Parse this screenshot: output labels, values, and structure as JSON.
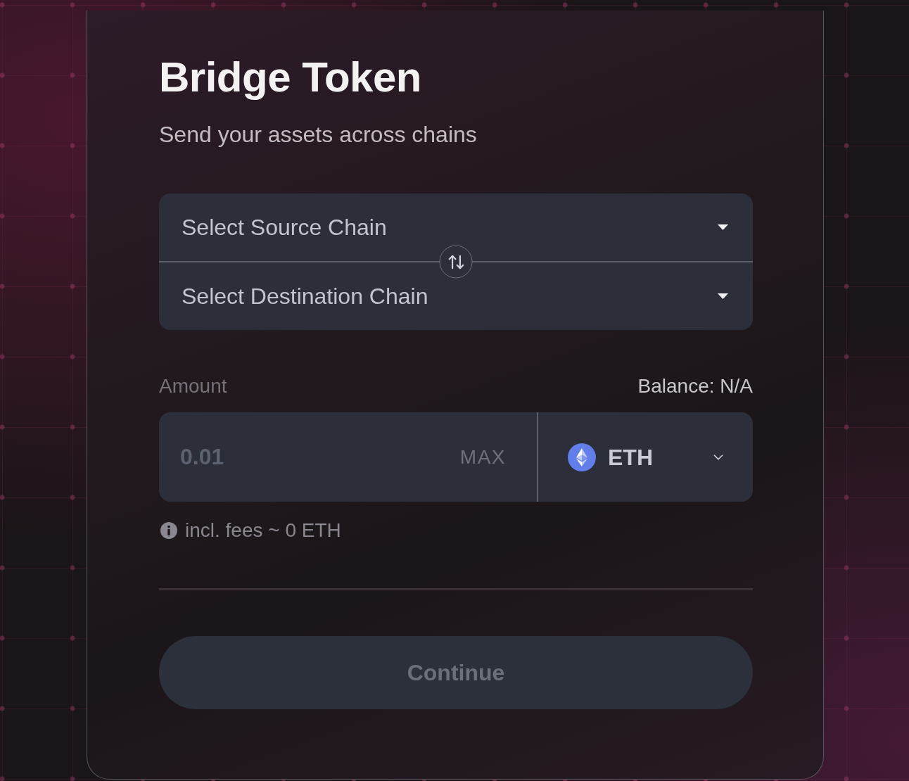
{
  "header": {
    "title": "Bridge Token",
    "subtitle": "Send your assets across chains"
  },
  "chain_selector": {
    "source": {
      "placeholder": "Select Source Chain"
    },
    "destination": {
      "placeholder": "Select Destination Chain"
    }
  },
  "amount": {
    "label": "Amount",
    "balance": "Balance: N/A",
    "placeholder": "0.01",
    "max_label": "MAX",
    "token": "ETH"
  },
  "fee_note": "incl. fees ~ 0 ETH",
  "continue_button": {
    "label": "Continue",
    "disabled": true
  }
}
